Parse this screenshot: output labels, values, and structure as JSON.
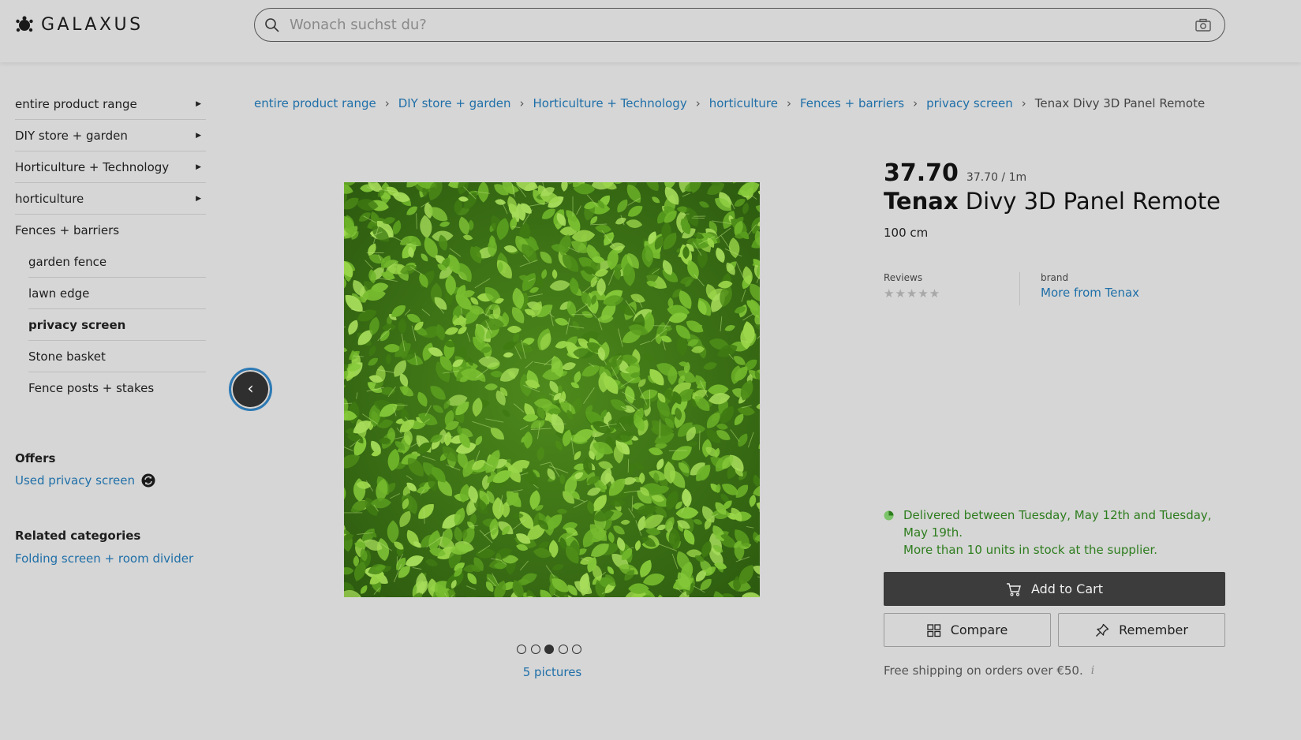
{
  "header": {
    "logo_text": "GALAXUS",
    "search_placeholder": "Wonach suchst du?"
  },
  "sidebar": {
    "items": [
      {
        "label": "entire product range"
      },
      {
        "label": "DIY store + garden"
      },
      {
        "label": "Horticulture + Technology"
      },
      {
        "label": "horticulture"
      },
      {
        "label": "Fences + barriers"
      }
    ],
    "sub_items": [
      {
        "label": "garden fence"
      },
      {
        "label": "lawn edge"
      },
      {
        "label": "privacy screen"
      },
      {
        "label": "Stone basket"
      },
      {
        "label": "Fence posts + stakes"
      }
    ],
    "offers_title": "Offers",
    "offers_link": "Used privacy screen",
    "related_title": "Related categories",
    "related_link": "Folding screen + room divider"
  },
  "breadcrumb": {
    "items": [
      "entire product range",
      "DIY store + garden",
      "Horticulture + Technology",
      "horticulture",
      "Fences + barriers",
      "privacy screen"
    ],
    "current": "Tenax Divy 3D Panel Remote"
  },
  "gallery": {
    "pictures_label": "5 pictures",
    "dot_count": 5,
    "active_dot": 3
  },
  "product": {
    "price": "37.70",
    "unit_price": "37.70 / 1m",
    "brand": "Tenax",
    "name": "Divy 3D Panel Remote",
    "variant": "100 cm",
    "reviews_label": "Reviews",
    "rating": "★★★★★",
    "brand_label": "brand",
    "brand_link": "More from Tenax",
    "delivery_line1": "Delivered between Tuesday, May 12th and Tuesday, May 19th.",
    "delivery_line2": "More than 10 units in stock at the supplier.",
    "add_to_cart": "Add to Cart",
    "compare": "Compare",
    "remember": "Remember",
    "shipping_note": "Free shipping on orders over €50.",
    "info_symbol": "i"
  },
  "colors": {
    "link": "#1f6fa8",
    "stock_green": "#2e7d1e",
    "cart_button": "#3c3c3c",
    "focus_ring": "#2d7ab5"
  }
}
